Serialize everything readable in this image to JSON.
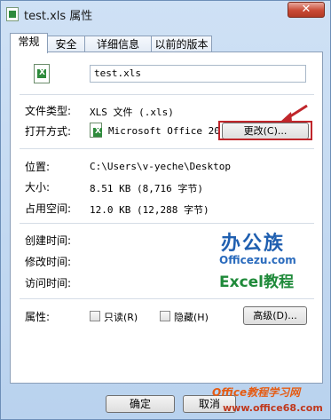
{
  "window": {
    "title": "test.xls 属性",
    "close_label": "✕"
  },
  "tabs": [
    {
      "label": "常规",
      "active": true
    },
    {
      "label": "安全",
      "active": false
    },
    {
      "label": "详细信息",
      "active": false
    },
    {
      "label": "以前的版本",
      "active": false
    }
  ],
  "general": {
    "filename": "test.xls",
    "rows": {
      "type": {
        "label": "文件类型:",
        "value": "XLS 文件 (.xls)"
      },
      "opens_with": {
        "label": "打开方式:",
        "value": "Microsoft Office 20",
        "change_button": "更改(C)..."
      },
      "location": {
        "label": "位置:",
        "value": "C:\\Users\\v-yeche\\Desktop"
      },
      "size": {
        "label": "大小:",
        "value": "8.51 KB (8,716 字节)"
      },
      "size_on_disk": {
        "label": "占用空间:",
        "value": "12.0 KB (12,288 字节)"
      },
      "created": {
        "label": "创建时间:"
      },
      "modified": {
        "label": "修改时间:"
      },
      "accessed": {
        "label": "访问时间:"
      }
    },
    "attributes": {
      "label": "属性:",
      "readonly": "只读(R)",
      "hidden": "隐藏(H)",
      "advanced": "高级(D)..."
    }
  },
  "footer": {
    "ok": "确定",
    "cancel": "取消"
  },
  "watermark": {
    "logo": "办公族",
    "domain": "Officezu.com",
    "excel": "Excel教程",
    "bottom": "Office教程学习网",
    "url": "www.office68.com"
  },
  "colors": {
    "highlight": "#c0262b",
    "accent": "#1f5fb0"
  }
}
